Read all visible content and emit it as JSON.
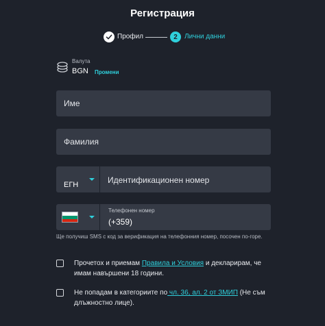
{
  "title": "Регистрация",
  "stepper": {
    "step1_label": "Профил",
    "step2_number": "2",
    "step2_label": "Лични данни"
  },
  "currency": {
    "label": "Валута",
    "value": "BGN",
    "change_link": "Промени"
  },
  "fields": {
    "first_name_placeholder": "Име",
    "last_name_placeholder": "Фамилия"
  },
  "id_document": {
    "type_value": "ЕГН",
    "number_placeholder": "Идентификационен номер"
  },
  "phone": {
    "label": "Телефонен номер",
    "prefix_value": "(+359)",
    "country_flag": "bulgaria-flag"
  },
  "sms_note": "Ще получиш SMS с код за верификация на телефонния номер, посочен по-горе.",
  "terms": {
    "text_before": "Прочетох и приемам ",
    "link": "Правила и Условия",
    "text_after": " и декларирам, че имам навършени 18 години."
  },
  "pep": {
    "text_before": "Не попадам в категориите по",
    "link": " чл. 36, ал. 2 от ЗМИП",
    "text_after": " (Не съм длъжностно лице)."
  },
  "colors": {
    "background": "#1e222b",
    "field": "#353a45",
    "accent": "#2fd0dc"
  }
}
